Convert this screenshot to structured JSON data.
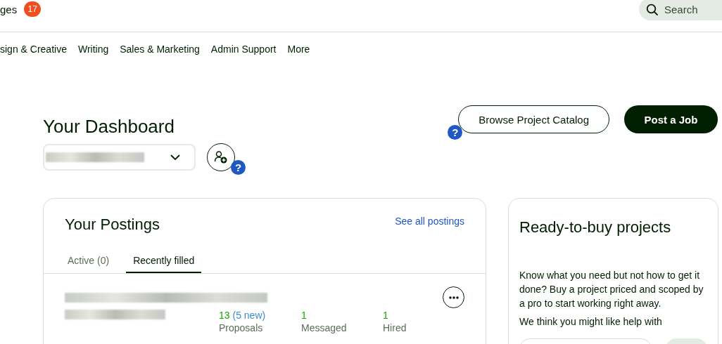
{
  "header": {
    "messages_label": "ges",
    "messages_count": "17",
    "search": {
      "placeholder": "Search"
    }
  },
  "categories": [
    {
      "label": "sign & Creative"
    },
    {
      "label": "Writing"
    },
    {
      "label": "Sales & Marketing"
    },
    {
      "label": "Admin Support"
    },
    {
      "label": "More"
    }
  ],
  "dashboard": {
    "title": "Your Dashboard",
    "help": "?",
    "help_2": "?",
    "browse_button": "Browse Project Catalog",
    "post_button": "Post a Job"
  },
  "postings": {
    "title": "Your Postings",
    "see_all": "See all postings",
    "tabs": [
      {
        "label": "Active (0)",
        "selected": false
      },
      {
        "label": "Recently filled",
        "selected": true
      }
    ],
    "job": {
      "stats": [
        {
          "value": "13",
          "extra": "(5 new)",
          "label": "Proposals"
        },
        {
          "value": "1",
          "label": "Messaged"
        },
        {
          "value": "1",
          "label": "Hired"
        }
      ]
    }
  },
  "ready": {
    "title": "Ready-to-buy projects",
    "body": "Know what you need but not how to get it done? Buy a project priced and scoped by a pro to start working right away.",
    "subtitle": "We think you might like help with"
  }
}
